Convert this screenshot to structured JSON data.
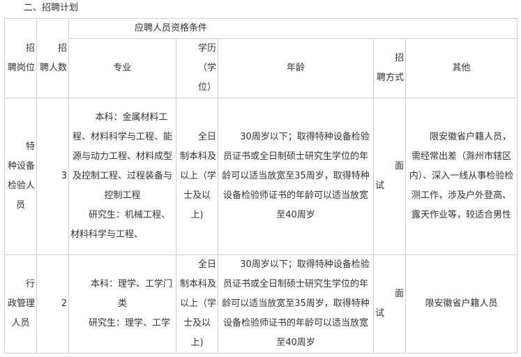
{
  "section_title": "二、招聘计划",
  "table": {
    "headers": {
      "position": "招聘岗位",
      "position_lines": [
        "招",
        "聘岗位"
      ],
      "count": "招聘人数",
      "count_lines": [
        "招",
        "聘人数"
      ],
      "qualifications_group": "应聘人员资格条件",
      "major": "专业",
      "education": "学历（学位）",
      "education_lines": [
        "学历",
        "（学",
        "位）"
      ],
      "age": "年龄",
      "method": "招聘方式",
      "method_lines": [
        "招",
        "聘方式"
      ],
      "other": "其他"
    },
    "rows": [
      {
        "position_lines": [
          "特",
          "种设备",
          "检验人",
          "员"
        ],
        "count": "3",
        "major_undergrad": "本科：金属材料工程、材料科学与工程、能源与动力工程、材料成型及控制工程、过程装备与控制工程",
        "major_graduate": "研究生：机械工程、材料科学与工程、",
        "education_lines": [
          "全日",
          "制本科及",
          "以上（学",
          "士及以",
          "上)"
        ],
        "age": "30周岁以下；取得特种设备检验员证书或全日制硕士研究生学位的年龄可以适当放宽至35周岁，取得特种设备检验师证书的年龄可以适当放宽至40周岁",
        "method_lines": [
          "面",
          "试"
        ],
        "other": "限安徽省户籍人员，需经常出差（滁州市辖区内）、深入一线从事检验检测工作，涉及户外登高、露天作业等，较适合男性"
      },
      {
        "position_lines": [
          "行",
          "政管理",
          "人员"
        ],
        "count": "2",
        "major_undergrad": "本科：理学、工学门类",
        "major_graduate": "研究生：理学、工学",
        "education_lines": [
          "全日",
          "制本科及",
          "以上（学",
          "士及以",
          "上)"
        ],
        "age": "30周岁以下；取得特种设备检验员证书或全日制硕士研究生学位的年龄可以适当放宽至35周岁，取得特种设备检验师证书的年龄可以适当放宽至40周岁",
        "method_lines": [
          "面",
          "试"
        ],
        "other": "限安徽省户籍人员"
      }
    ]
  }
}
